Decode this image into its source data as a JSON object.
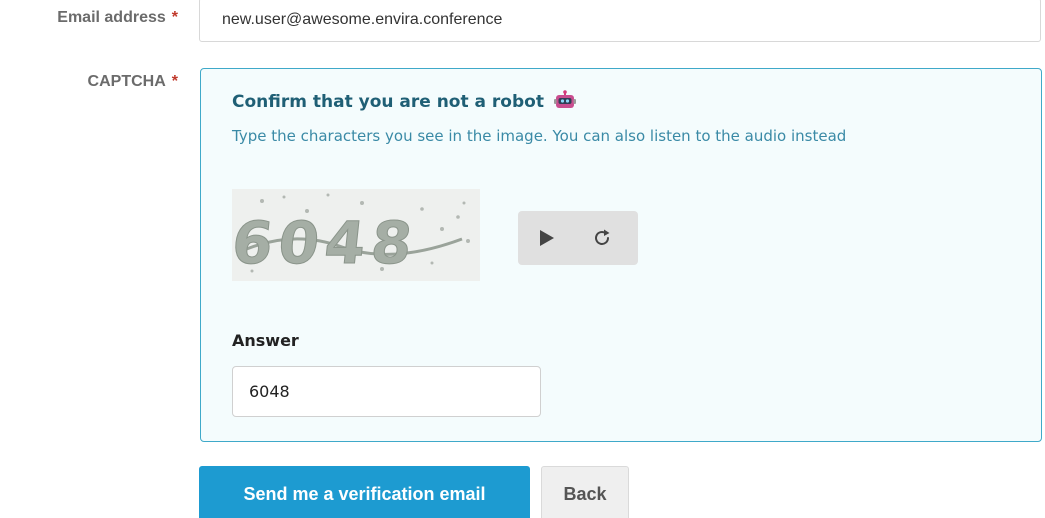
{
  "email": {
    "label": "Email address",
    "required_mark": "*",
    "value": "new.user@awesome.envira.conference"
  },
  "captcha": {
    "label": "CAPTCHA",
    "required_mark": "*",
    "title": "Confirm that you are not a robot",
    "title_icon": "robot-icon",
    "hint": "Type the characters you see in the image. You can also listen to the audio instead",
    "image_text": "6048",
    "play_icon": "play-icon",
    "refresh_icon": "refresh-icon",
    "answer_label": "Answer",
    "answer_value": "6048"
  },
  "actions": {
    "submit_label": "Send me a verification email",
    "back_label": "Back"
  },
  "colors": {
    "accent": "#1d9bd1",
    "captcha_border": "#3fa9c9",
    "captcha_bg": "#f4fcfd",
    "title_text": "#1f5f75",
    "required": "#c0392b"
  }
}
